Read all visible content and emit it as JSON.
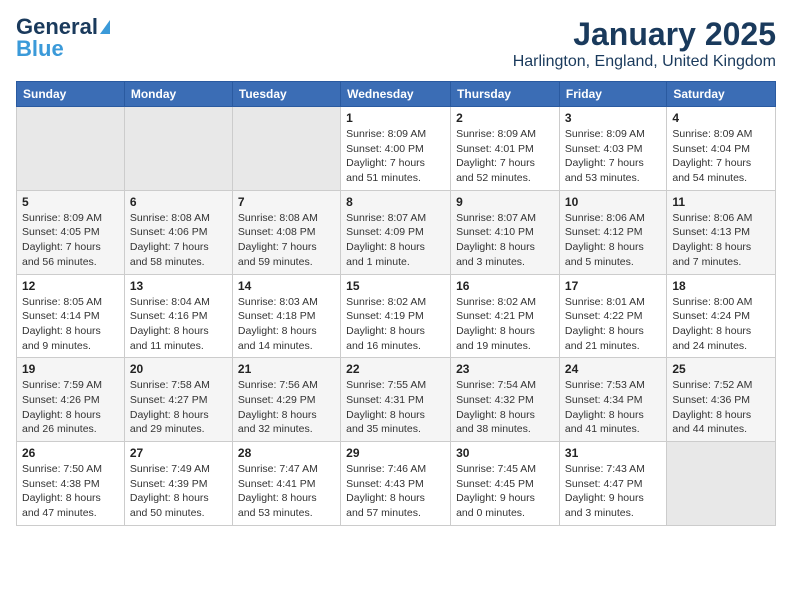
{
  "header": {
    "logo_line1": "General",
    "logo_line2": "Blue",
    "title": "January 2025",
    "subtitle": "Harlington, England, United Kingdom"
  },
  "days_of_week": [
    "Sunday",
    "Monday",
    "Tuesday",
    "Wednesday",
    "Thursday",
    "Friday",
    "Saturday"
  ],
  "weeks": [
    [
      {
        "day": "",
        "info": ""
      },
      {
        "day": "",
        "info": ""
      },
      {
        "day": "",
        "info": ""
      },
      {
        "day": "1",
        "info": "Sunrise: 8:09 AM\nSunset: 4:00 PM\nDaylight: 7 hours and 51 minutes."
      },
      {
        "day": "2",
        "info": "Sunrise: 8:09 AM\nSunset: 4:01 PM\nDaylight: 7 hours and 52 minutes."
      },
      {
        "day": "3",
        "info": "Sunrise: 8:09 AM\nSunset: 4:03 PM\nDaylight: 7 hours and 53 minutes."
      },
      {
        "day": "4",
        "info": "Sunrise: 8:09 AM\nSunset: 4:04 PM\nDaylight: 7 hours and 54 minutes."
      }
    ],
    [
      {
        "day": "5",
        "info": "Sunrise: 8:09 AM\nSunset: 4:05 PM\nDaylight: 7 hours and 56 minutes."
      },
      {
        "day": "6",
        "info": "Sunrise: 8:08 AM\nSunset: 4:06 PM\nDaylight: 7 hours and 58 minutes."
      },
      {
        "day": "7",
        "info": "Sunrise: 8:08 AM\nSunset: 4:08 PM\nDaylight: 7 hours and 59 minutes."
      },
      {
        "day": "8",
        "info": "Sunrise: 8:07 AM\nSunset: 4:09 PM\nDaylight: 8 hours and 1 minute."
      },
      {
        "day": "9",
        "info": "Sunrise: 8:07 AM\nSunset: 4:10 PM\nDaylight: 8 hours and 3 minutes."
      },
      {
        "day": "10",
        "info": "Sunrise: 8:06 AM\nSunset: 4:12 PM\nDaylight: 8 hours and 5 minutes."
      },
      {
        "day": "11",
        "info": "Sunrise: 8:06 AM\nSunset: 4:13 PM\nDaylight: 8 hours and 7 minutes."
      }
    ],
    [
      {
        "day": "12",
        "info": "Sunrise: 8:05 AM\nSunset: 4:14 PM\nDaylight: 8 hours and 9 minutes."
      },
      {
        "day": "13",
        "info": "Sunrise: 8:04 AM\nSunset: 4:16 PM\nDaylight: 8 hours and 11 minutes."
      },
      {
        "day": "14",
        "info": "Sunrise: 8:03 AM\nSunset: 4:18 PM\nDaylight: 8 hours and 14 minutes."
      },
      {
        "day": "15",
        "info": "Sunrise: 8:02 AM\nSunset: 4:19 PM\nDaylight: 8 hours and 16 minutes."
      },
      {
        "day": "16",
        "info": "Sunrise: 8:02 AM\nSunset: 4:21 PM\nDaylight: 8 hours and 19 minutes."
      },
      {
        "day": "17",
        "info": "Sunrise: 8:01 AM\nSunset: 4:22 PM\nDaylight: 8 hours and 21 minutes."
      },
      {
        "day": "18",
        "info": "Sunrise: 8:00 AM\nSunset: 4:24 PM\nDaylight: 8 hours and 24 minutes."
      }
    ],
    [
      {
        "day": "19",
        "info": "Sunrise: 7:59 AM\nSunset: 4:26 PM\nDaylight: 8 hours and 26 minutes."
      },
      {
        "day": "20",
        "info": "Sunrise: 7:58 AM\nSunset: 4:27 PM\nDaylight: 8 hours and 29 minutes."
      },
      {
        "day": "21",
        "info": "Sunrise: 7:56 AM\nSunset: 4:29 PM\nDaylight: 8 hours and 32 minutes."
      },
      {
        "day": "22",
        "info": "Sunrise: 7:55 AM\nSunset: 4:31 PM\nDaylight: 8 hours and 35 minutes."
      },
      {
        "day": "23",
        "info": "Sunrise: 7:54 AM\nSunset: 4:32 PM\nDaylight: 8 hours and 38 minutes."
      },
      {
        "day": "24",
        "info": "Sunrise: 7:53 AM\nSunset: 4:34 PM\nDaylight: 8 hours and 41 minutes."
      },
      {
        "day": "25",
        "info": "Sunrise: 7:52 AM\nSunset: 4:36 PM\nDaylight: 8 hours and 44 minutes."
      }
    ],
    [
      {
        "day": "26",
        "info": "Sunrise: 7:50 AM\nSunset: 4:38 PM\nDaylight: 8 hours and 47 minutes."
      },
      {
        "day": "27",
        "info": "Sunrise: 7:49 AM\nSunset: 4:39 PM\nDaylight: 8 hours and 50 minutes."
      },
      {
        "day": "28",
        "info": "Sunrise: 7:47 AM\nSunset: 4:41 PM\nDaylight: 8 hours and 53 minutes."
      },
      {
        "day": "29",
        "info": "Sunrise: 7:46 AM\nSunset: 4:43 PM\nDaylight: 8 hours and 57 minutes."
      },
      {
        "day": "30",
        "info": "Sunrise: 7:45 AM\nSunset: 4:45 PM\nDaylight: 9 hours and 0 minutes."
      },
      {
        "day": "31",
        "info": "Sunrise: 7:43 AM\nSunset: 4:47 PM\nDaylight: 9 hours and 3 minutes."
      },
      {
        "day": "",
        "info": ""
      }
    ]
  ]
}
